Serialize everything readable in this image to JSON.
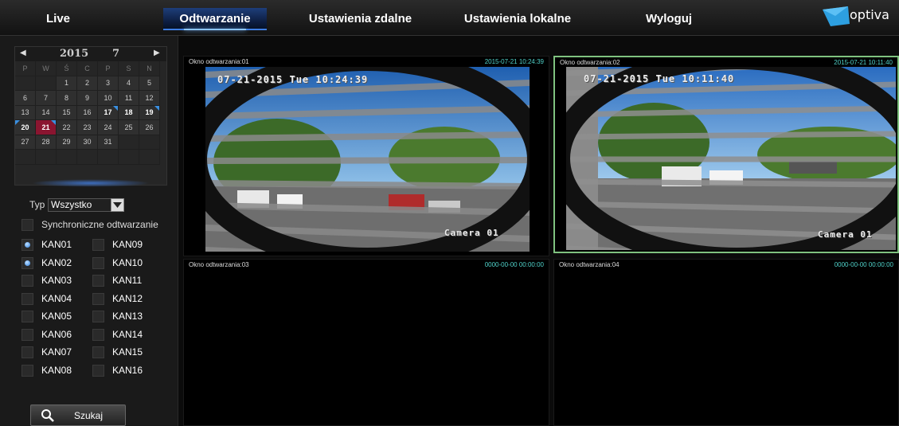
{
  "nav": {
    "tabs": [
      "Live",
      "Odtwarzanie",
      "Ustawienia zdalne",
      "Ustawienia lokalne",
      "Wyloguj"
    ],
    "active_tab": "Odtwarzanie",
    "logo_text": "optiva",
    "accent_color": "#3d7ce0"
  },
  "calendar": {
    "year": "2015",
    "month": "7",
    "weekdays": [
      "P",
      "W",
      "Ś",
      "C",
      "P",
      "S",
      "N"
    ],
    "selected_day": "21",
    "selected_color": "#8a1530",
    "weeks": [
      [
        "",
        "",
        "1",
        "2",
        "3",
        "4",
        "5"
      ],
      [
        "6",
        "7",
        "8",
        "9",
        "10",
        "11",
        "12"
      ],
      [
        "13",
        "14",
        "15",
        "16",
        "17",
        "18",
        "19"
      ],
      [
        "20",
        "21",
        "22",
        "23",
        "24",
        "25",
        "26"
      ],
      [
        "27",
        "28",
        "29",
        "30",
        "31",
        "",
        ""
      ]
    ],
    "record_days": [
      "17",
      "19",
      "20",
      "21"
    ],
    "bold_days": [
      "17",
      "18",
      "19",
      "20",
      "21"
    ]
  },
  "filters": {
    "type_label": "Typ",
    "type_value": "Wszystko",
    "sync_label": "Synchroniczne odtwarzanie",
    "channels": [
      {
        "label": "KAN01",
        "checked": true
      },
      {
        "label": "KAN02",
        "checked": true
      },
      {
        "label": "KAN03",
        "checked": false
      },
      {
        "label": "KAN04",
        "checked": false
      },
      {
        "label": "KAN05",
        "checked": false
      },
      {
        "label": "KAN06",
        "checked": false
      },
      {
        "label": "KAN07",
        "checked": false
      },
      {
        "label": "KAN08",
        "checked": false
      },
      {
        "label": "KAN09",
        "checked": false
      },
      {
        "label": "KAN10",
        "checked": false
      },
      {
        "label": "KAN11",
        "checked": false
      },
      {
        "label": "KAN12",
        "checked": false
      },
      {
        "label": "KAN13",
        "checked": false
      },
      {
        "label": "KAN14",
        "checked": false
      },
      {
        "label": "KAN15",
        "checked": false
      },
      {
        "label": "KAN16",
        "checked": false
      }
    ],
    "search_label": "Szukaj"
  },
  "panes": [
    {
      "title": "Okno odtwarzania:01",
      "time": "2015-07-21 10:24:39",
      "osd_date": "07-21-2015 Tue 10:24:39",
      "osd_cam": "Camera 01",
      "has_video": true
    },
    {
      "title": "Okno odtwarzania:02",
      "time": "2015-07-21 10:11:40",
      "osd_date": "07-21-2015 Tue 10:11:40",
      "osd_cam": "Camera 01",
      "has_video": true
    },
    {
      "title": "Okno odtwarzania:03",
      "time": "0000-00-00 00:00:00",
      "has_video": false
    },
    {
      "title": "Okno odtwarzania:04",
      "time": "0000-00-00 00:00:00",
      "has_video": false
    }
  ],
  "time_color": "#4fd0c8",
  "active_pane_color": "#7fc27f"
}
